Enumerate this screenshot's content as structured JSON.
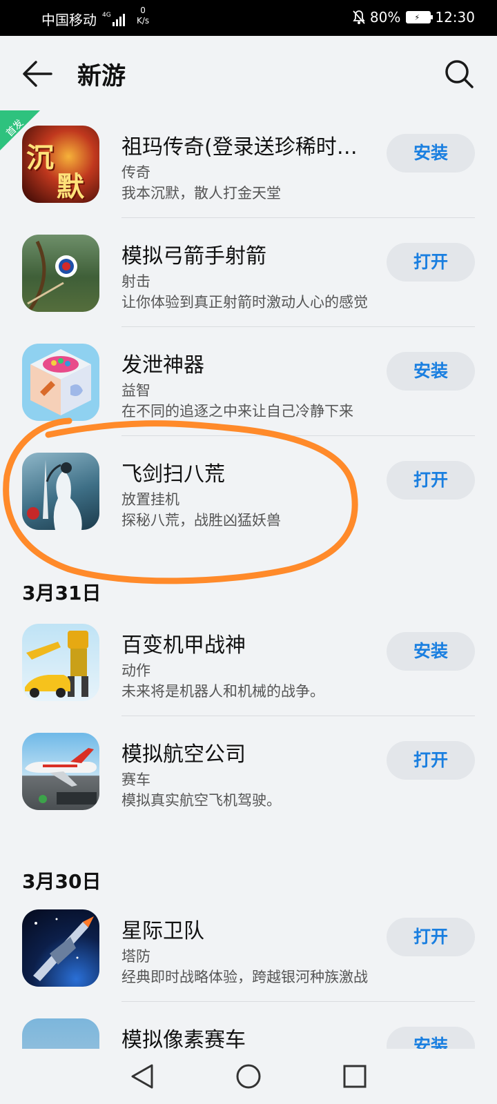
{
  "status_bar": {
    "carrier": "中国移动",
    "network": "4G",
    "speed_value": "0",
    "speed_unit": "K/s",
    "battery": "80%",
    "time": "12:30"
  },
  "header": {
    "title": "新游"
  },
  "badge": "首发",
  "groups": [
    {
      "date": "",
      "apps": [
        {
          "name": "祖玛传奇(登录送珍稀时…",
          "category": "传奇",
          "description": "我本沉默，散人打金天堂",
          "button": "安装"
        },
        {
          "name": "模拟弓箭手射箭",
          "category": "射击",
          "description": "让你体验到真正射箭时激动人心的感觉",
          "button": "打开"
        },
        {
          "name": "发泄神器",
          "category": "益智",
          "description": "在不同的追逐之中来让自己冷静下来",
          "button": "安装"
        },
        {
          "name": "飞剑扫八荒",
          "category": "放置挂机",
          "description": "探秘八荒，战胜凶猛妖兽",
          "button": "打开"
        }
      ]
    },
    {
      "date": "3月31日",
      "apps": [
        {
          "name": "百变机甲战神",
          "category": "动作",
          "description": "未来将是机器人和机械的战争。",
          "button": "安装"
        },
        {
          "name": "模拟航空公司",
          "category": "赛车",
          "description": "模拟真实航空飞机驾驶。",
          "button": "打开"
        }
      ]
    },
    {
      "date": "3月30日",
      "apps": [
        {
          "name": "星际卫队",
          "category": "塔防",
          "description": "经典即时战略体验，跨越银河种族激战",
          "button": "打开"
        },
        {
          "name": "模拟像素赛车",
          "category": "",
          "description": "",
          "button": "安装"
        }
      ]
    }
  ],
  "colors": {
    "accent": "#1a7fe0",
    "highlight_stroke": "#ff8a2a",
    "badge": "#2ec27e"
  }
}
